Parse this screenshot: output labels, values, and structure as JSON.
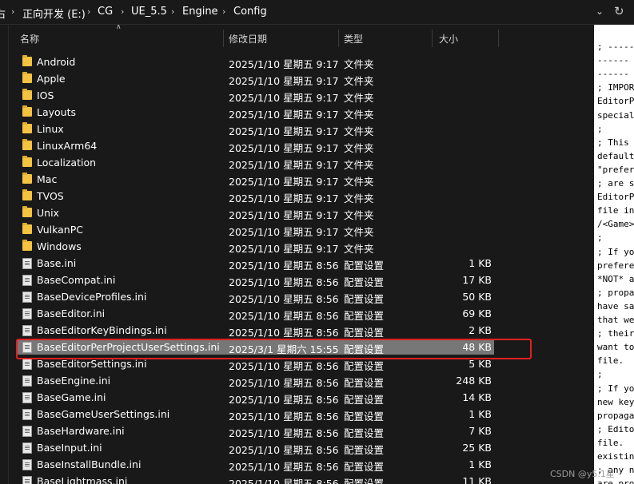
{
  "address_bar": {
    "crumbs": [
      "右",
      "正向开发 (E:)",
      "CG",
      "UE_5.5",
      "Engine",
      "Config"
    ],
    "separator": "›",
    "chevron_icon": "chevron-down-icon",
    "refresh_icon": "refresh-icon"
  },
  "columns": {
    "name": "名称",
    "date": "修改日期",
    "type": "类型",
    "size": "大小"
  },
  "files": [
    {
      "name": "Android",
      "date": "2025/1/10 星期五 9:17",
      "type": "文件夹",
      "size": "",
      "icon": "folder-icon"
    },
    {
      "name": "Apple",
      "date": "2025/1/10 星期五 9:17",
      "type": "文件夹",
      "size": "",
      "icon": "folder-icon"
    },
    {
      "name": "IOS",
      "date": "2025/1/10 星期五 9:17",
      "type": "文件夹",
      "size": "",
      "icon": "folder-icon"
    },
    {
      "name": "Layouts",
      "date": "2025/1/10 星期五 9:17",
      "type": "文件夹",
      "size": "",
      "icon": "folder-icon"
    },
    {
      "name": "Linux",
      "date": "2025/1/10 星期五 9:17",
      "type": "文件夹",
      "size": "",
      "icon": "folder-icon"
    },
    {
      "name": "LinuxArm64",
      "date": "2025/1/10 星期五 9:17",
      "type": "文件夹",
      "size": "",
      "icon": "folder-icon"
    },
    {
      "name": "Localization",
      "date": "2025/1/10 星期五 9:17",
      "type": "文件夹",
      "size": "",
      "icon": "folder-icon"
    },
    {
      "name": "Mac",
      "date": "2025/1/10 星期五 9:17",
      "type": "文件夹",
      "size": "",
      "icon": "folder-icon"
    },
    {
      "name": "TVOS",
      "date": "2025/1/10 星期五 9:17",
      "type": "文件夹",
      "size": "",
      "icon": "folder-icon"
    },
    {
      "name": "Unix",
      "date": "2025/1/10 星期五 9:17",
      "type": "文件夹",
      "size": "",
      "icon": "folder-icon"
    },
    {
      "name": "VulkanPC",
      "date": "2025/1/10 星期五 9:17",
      "type": "文件夹",
      "size": "",
      "icon": "folder-icon"
    },
    {
      "name": "Windows",
      "date": "2025/1/10 星期五 9:17",
      "type": "文件夹",
      "size": "",
      "icon": "folder-icon"
    },
    {
      "name": "Base.ini",
      "date": "2025/1/10 星期五 8:56",
      "type": "配置设置",
      "size": "1 KB",
      "icon": "ini-file-icon"
    },
    {
      "name": "BaseCompat.ini",
      "date": "2025/1/10 星期五 8:56",
      "type": "配置设置",
      "size": "17 KB",
      "icon": "ini-file-icon"
    },
    {
      "name": "BaseDeviceProfiles.ini",
      "date": "2025/1/10 星期五 8:56",
      "type": "配置设置",
      "size": "50 KB",
      "icon": "ini-file-icon"
    },
    {
      "name": "BaseEditor.ini",
      "date": "2025/1/10 星期五 8:56",
      "type": "配置设置",
      "size": "69 KB",
      "icon": "ini-file-icon"
    },
    {
      "name": "BaseEditorKeyBindings.ini",
      "date": "2025/1/10 星期五 8:56",
      "type": "配置设置",
      "size": "2 KB",
      "icon": "ini-file-icon"
    },
    {
      "name": "BaseEditorPerProjectUserSettings.ini",
      "date": "2025/3/1 星期六 15:55",
      "type": "配置设置",
      "size": "48 KB",
      "icon": "ini-file-icon",
      "selected": true
    },
    {
      "name": "BaseEditorSettings.ini",
      "date": "2025/1/10 星期五 8:56",
      "type": "配置设置",
      "size": "5 KB",
      "icon": "ini-file-icon"
    },
    {
      "name": "BaseEngine.ini",
      "date": "2025/1/10 星期五 8:56",
      "type": "配置设置",
      "size": "248 KB",
      "icon": "ini-file-icon"
    },
    {
      "name": "BaseGame.ini",
      "date": "2025/1/10 星期五 8:56",
      "type": "配置设置",
      "size": "14 KB",
      "icon": "ini-file-icon"
    },
    {
      "name": "BaseGameUserSettings.ini",
      "date": "2025/1/10 星期五 8:56",
      "type": "配置设置",
      "size": "1 KB",
      "icon": "ini-file-icon"
    },
    {
      "name": "BaseHardware.ini",
      "date": "2025/1/10 星期五 8:56",
      "type": "配置设置",
      "size": "7 KB",
      "icon": "ini-file-icon"
    },
    {
      "name": "BaseInput.ini",
      "date": "2025/1/10 星期五 8:56",
      "type": "配置设置",
      "size": "25 KB",
      "icon": "ini-file-icon"
    },
    {
      "name": "BaseInstallBundle.ini",
      "date": "2025/1/10 星期五 8:56",
      "type": "配置设置",
      "size": "1 KB",
      "icon": "ini-file-icon"
    },
    {
      "name": "BaseLightmass.ini",
      "date": "2025/1/10 星期五 8:56",
      "type": "配置设置",
      "size": "11 KB",
      "icon": "ini-file-icon"
    }
  ],
  "editor_lines": [
    "; -----",
    "------",
    "------",
    "; IMPOR",
    "EditorP",
    "special",
    ";",
    "; This",
    "default",
    "\"prefer",
    "; are s",
    "EditorP",
    "file in",
    "/<Game>",
    ";",
    "; If yo",
    "prefere",
    "*NOT* a",
    "; propa",
    "have sa",
    "that we",
    "; their",
    "want to",
    "file.",
    ";",
    "; If yo",
    "new key",
    "propaga",
    "; Edito",
    "file.",
    "existin",
    "; any n",
    "are pro"
  ],
  "watermark": "CSDN @y5.1星"
}
